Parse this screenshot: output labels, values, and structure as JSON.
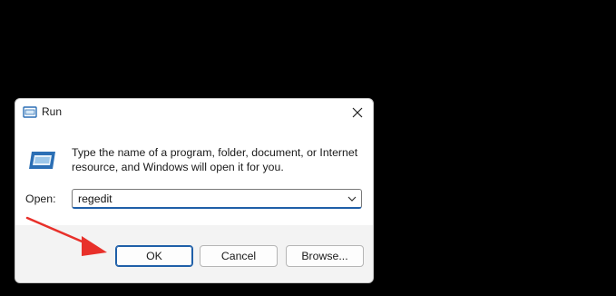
{
  "window": {
    "title": "Run",
    "title_icon": "run-icon"
  },
  "dialog": {
    "description": "Type the name of a program, folder, document, or Internet resource, and Windows will open it for you.",
    "open_label": "Open:",
    "open_value": "regedit"
  },
  "buttons": {
    "ok": "OK",
    "cancel": "Cancel",
    "browse": "Browse..."
  },
  "colors": {
    "accent": "#1f5fa8",
    "annotation_arrow": "#e8302a",
    "background": "#000000"
  }
}
